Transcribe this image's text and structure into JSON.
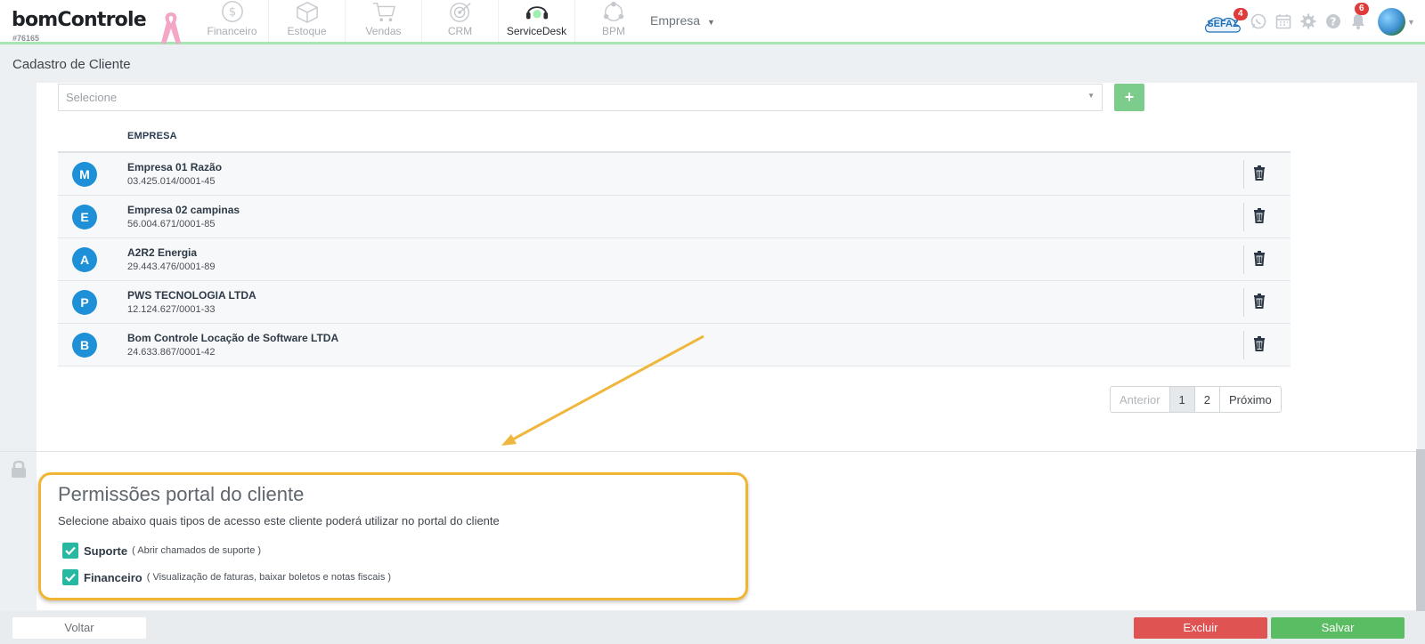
{
  "header": {
    "logo": "bomControle",
    "account_code": "#76165",
    "modules": [
      {
        "label": "Financeiro",
        "icon": "dollar-circle-icon",
        "active": false
      },
      {
        "label": "Estoque",
        "icon": "box-icon",
        "active": false
      },
      {
        "label": "Vendas",
        "icon": "cart-icon",
        "active": false
      },
      {
        "label": "CRM",
        "icon": "target-icon",
        "active": false
      },
      {
        "label": "ServiceDesk",
        "icon": "headset-icon",
        "active": true
      },
      {
        "label": "BPM",
        "icon": "network-icon",
        "active": false
      }
    ],
    "company_menu": "Empresa",
    "sefaz_label": "SEFAZ",
    "sefaz_badge": "4",
    "notifications_badge": "6"
  },
  "page": {
    "title": "Cadastro de Cliente"
  },
  "company_select": {
    "placeholder": "Selecione",
    "add_label": "+"
  },
  "table": {
    "column_header": "EMPRESA",
    "rows": [
      {
        "initial": "M",
        "name": "Empresa 01 Razão",
        "cnpj": "03.425.014/0001-45"
      },
      {
        "initial": "E",
        "name": "Empresa 02 campinas",
        "cnpj": "56.004.671/0001-85"
      },
      {
        "initial": "A",
        "name": "A2R2 Energia",
        "cnpj": "29.443.476/0001-89"
      },
      {
        "initial": "P",
        "name": "PWS TECNOLOGIA LTDA",
        "cnpj": "12.124.627/0001-33"
      },
      {
        "initial": "B",
        "name": "Bom Controle Locação de Software LTDA",
        "cnpj": "24.633.867/0001-42"
      }
    ]
  },
  "pagination": {
    "prev": "Anterior",
    "pages": [
      "1",
      "2"
    ],
    "next": "Próximo",
    "current": "1"
  },
  "permissions": {
    "title": "Permissões portal do cliente",
    "subtitle": "Selecione abaixo quais tipos de acesso este cliente poderá utilizar no portal do cliente",
    "options": [
      {
        "label": "Suporte",
        "description": "( Abrir chamados de suporte )",
        "checked": true
      },
      {
        "label": "Financeiro",
        "description": "( Visualização de faturas, baixar boletos e notas fiscais )",
        "checked": true
      }
    ]
  },
  "footer": {
    "back_label": "Voltar",
    "delete_label": "Excluir",
    "save_label": "Salvar"
  },
  "colors": {
    "accent_green": "#5bbd63",
    "danger_red": "#e05353",
    "avatar_blue": "#1e90d8",
    "highlight_orange": "#f1b534",
    "checkbox_teal": "#26b8a0"
  }
}
